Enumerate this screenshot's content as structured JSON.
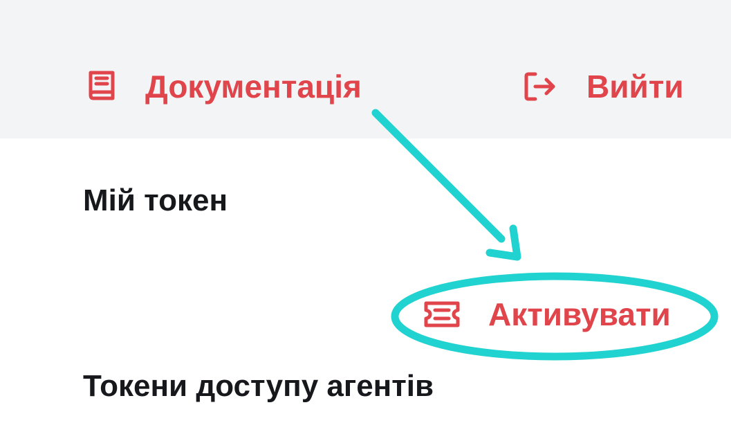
{
  "header": {
    "docs_label": "Документація",
    "logout_label": "Вийти"
  },
  "sections": {
    "my_token_title": "Мій токен",
    "activate_label": "Активувати",
    "agent_tokens_title": "Токени доступу агентів"
  },
  "icons": {
    "docs": "book-icon",
    "logout": "logout-icon",
    "activate": "ticket-icon"
  },
  "colors": {
    "accent": "#e0454b",
    "header_background": "#f3f4f6",
    "text": "#17181c",
    "annotation": "#20d3d0"
  }
}
